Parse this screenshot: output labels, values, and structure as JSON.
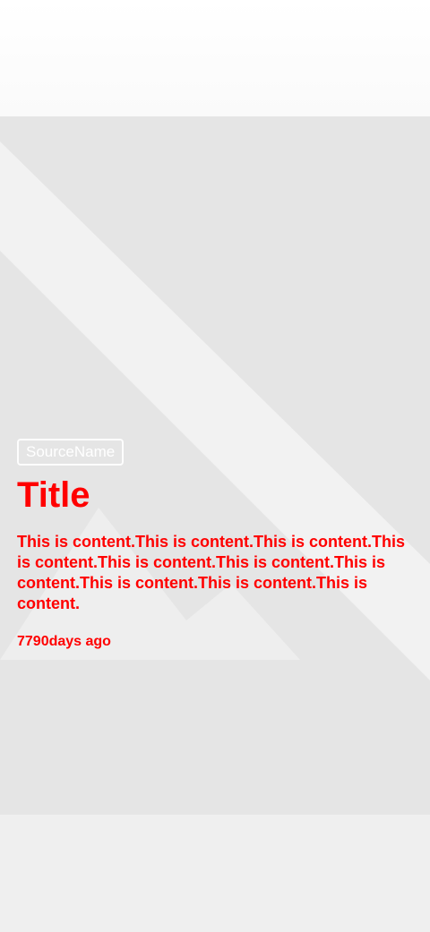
{
  "article": {
    "source_name": "SourceName",
    "title": "Title",
    "content": "This is content.This is content.This is content.This is content.This is content.This is content.This is content.This is content.This is content.This is content.",
    "time_ago": "7790days ago"
  },
  "placeholder_image": {
    "icon": "image-placeholder-icon"
  },
  "colors": {
    "accent": "#ff0000",
    "background": "#e5e5e5",
    "badge_text": "#ffffff"
  }
}
